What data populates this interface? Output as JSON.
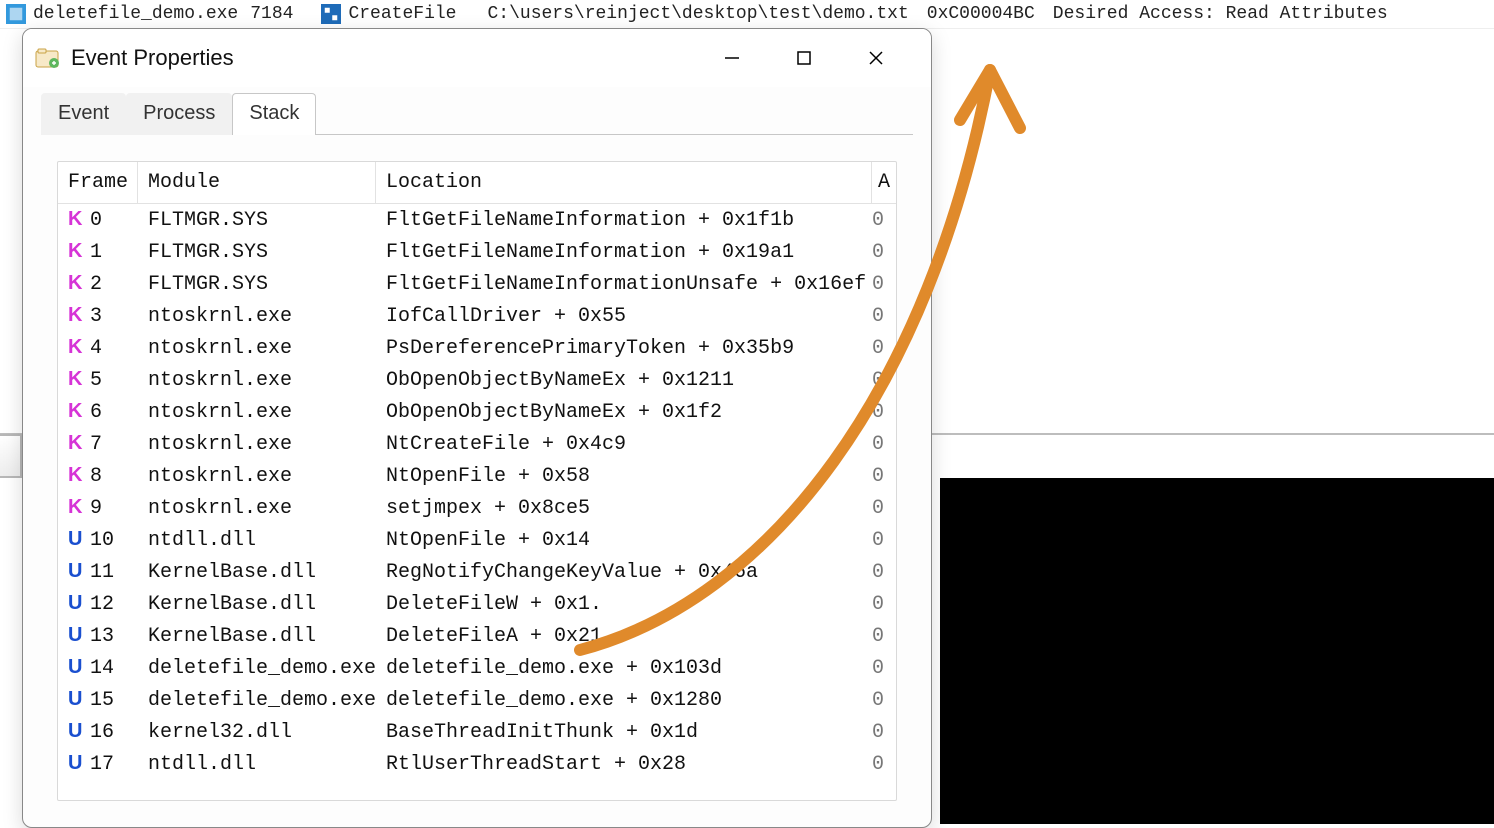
{
  "topbar": {
    "process": "deletefile_demo.exe",
    "pid": "7184",
    "operation": "CreateFile",
    "path": "C:\\users\\reinject\\desktop\\test\\demo.txt",
    "result": "0xC00004BC",
    "detail": "Desired Access: Read Attributes"
  },
  "dialog": {
    "title": "Event Properties",
    "tabs": {
      "event": "Event",
      "process": "Process",
      "stack": "Stack"
    },
    "headers": {
      "frame": "Frame",
      "module": "Module",
      "location": "Location",
      "a": "A"
    },
    "rows": [
      {
        "mode": "K",
        "idx": "0",
        "module": "FLTMGR.SYS",
        "location": "FltGetFileNameInformation + 0x1f1b",
        "a": "0"
      },
      {
        "mode": "K",
        "idx": "1",
        "module": "FLTMGR.SYS",
        "location": "FltGetFileNameInformation + 0x19a1",
        "a": "0"
      },
      {
        "mode": "K",
        "idx": "2",
        "module": "FLTMGR.SYS",
        "location": "FltGetFileNameInformationUnsafe + 0x16ef",
        "a": "0"
      },
      {
        "mode": "K",
        "idx": "3",
        "module": "ntoskrnl.exe",
        "location": "IofCallDriver + 0x55",
        "a": "0"
      },
      {
        "mode": "K",
        "idx": "4",
        "module": "ntoskrnl.exe",
        "location": "PsDereferencePrimaryToken + 0x35b9",
        "a": "0"
      },
      {
        "mode": "K",
        "idx": "5",
        "module": "ntoskrnl.exe",
        "location": "ObOpenObjectByNameEx + 0x1211",
        "a": "0"
      },
      {
        "mode": "K",
        "idx": "6",
        "module": "ntoskrnl.exe",
        "location": "ObOpenObjectByNameEx + 0x1f2",
        "a": "0"
      },
      {
        "mode": "K",
        "idx": "7",
        "module": "ntoskrnl.exe",
        "location": "NtCreateFile + 0x4c9",
        "a": "0"
      },
      {
        "mode": "K",
        "idx": "8",
        "module": "ntoskrnl.exe",
        "location": "NtOpenFile + 0x58",
        "a": "0"
      },
      {
        "mode": "K",
        "idx": "9",
        "module": "ntoskrnl.exe",
        "location": "setjmpex + 0x8ce5",
        "a": "0"
      },
      {
        "mode": "U",
        "idx": "10",
        "module": "ntdll.dll",
        "location": "NtOpenFile + 0x14",
        "a": "0"
      },
      {
        "mode": "U",
        "idx": "11",
        "module": "KernelBase.dll",
        "location": "RegNotifyChangeKeyValue + 0x46a",
        "a": "0"
      },
      {
        "mode": "U",
        "idx": "12",
        "module": "KernelBase.dll",
        "location": "DeleteFileW + 0x1.",
        "a": "0"
      },
      {
        "mode": "U",
        "idx": "13",
        "module": "KernelBase.dll",
        "location": "DeleteFileA + 0x21",
        "a": "0"
      },
      {
        "mode": "U",
        "idx": "14",
        "module": "deletefile_demo.exe",
        "location": "deletefile_demo.exe + 0x103d",
        "a": "0"
      },
      {
        "mode": "U",
        "idx": "15",
        "module": "deletefile_demo.exe",
        "location": "deletefile_demo.exe + 0x1280",
        "a": "0"
      },
      {
        "mode": "U",
        "idx": "16",
        "module": "kernel32.dll",
        "location": "BaseThreadInitThunk + 0x1d",
        "a": "0"
      },
      {
        "mode": "U",
        "idx": "17",
        "module": "ntdll.dll",
        "location": "RtlUserThreadStart + 0x28",
        "a": "0"
      }
    ]
  }
}
